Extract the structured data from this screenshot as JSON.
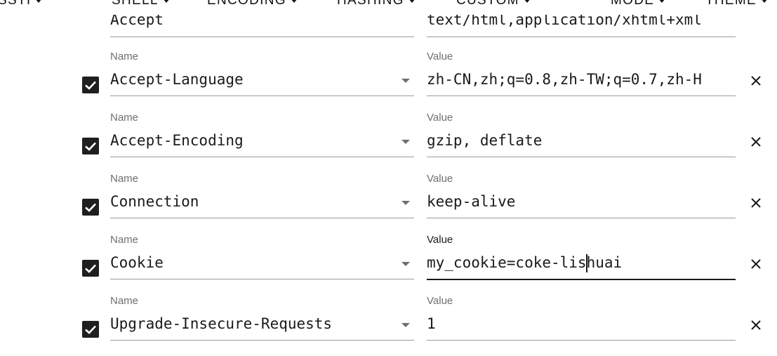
{
  "menu": [
    {
      "label": "SSTI"
    },
    {
      "label": "SHELL"
    },
    {
      "label": "ENCODING"
    },
    {
      "label": "HASHING"
    },
    {
      "label": "CUSTOM"
    },
    {
      "label": "MODE"
    },
    {
      "label": "THEME"
    }
  ],
  "headers": {
    "partial_top": {
      "name": "Accept",
      "value": "text/html,application/xhtml+xml"
    },
    "rows": [
      {
        "name_label": "Name",
        "name": "Accept-Language",
        "value_label": "Value",
        "value": "zh-CN,zh;q=0.8,zh-TW;q=0.7,zh-H",
        "enabled": true
      },
      {
        "name_label": "Name",
        "name": "Accept-Encoding",
        "value_label": "Value",
        "value": "gzip, deflate",
        "enabled": true
      },
      {
        "name_label": "Name",
        "name": "Connection",
        "value_label": "Value",
        "value": "keep-alive",
        "enabled": true
      },
      {
        "name_label": "Name",
        "name": "Cookie",
        "value_label": "Value",
        "value_before_cursor": "my_cookie=coke-lis",
        "value_after_cursor": "huai",
        "enabled": true,
        "focused": true
      },
      {
        "name_label": "Name",
        "name": "Upgrade-Insecure-Requests",
        "value_label": "Value",
        "value": "1",
        "enabled": true
      }
    ]
  },
  "icons": {
    "checkbox": "check-icon",
    "remove": "close-icon",
    "dropdown": "dropdown-arrow-icon",
    "menu_caret": "caret-down-icon"
  }
}
